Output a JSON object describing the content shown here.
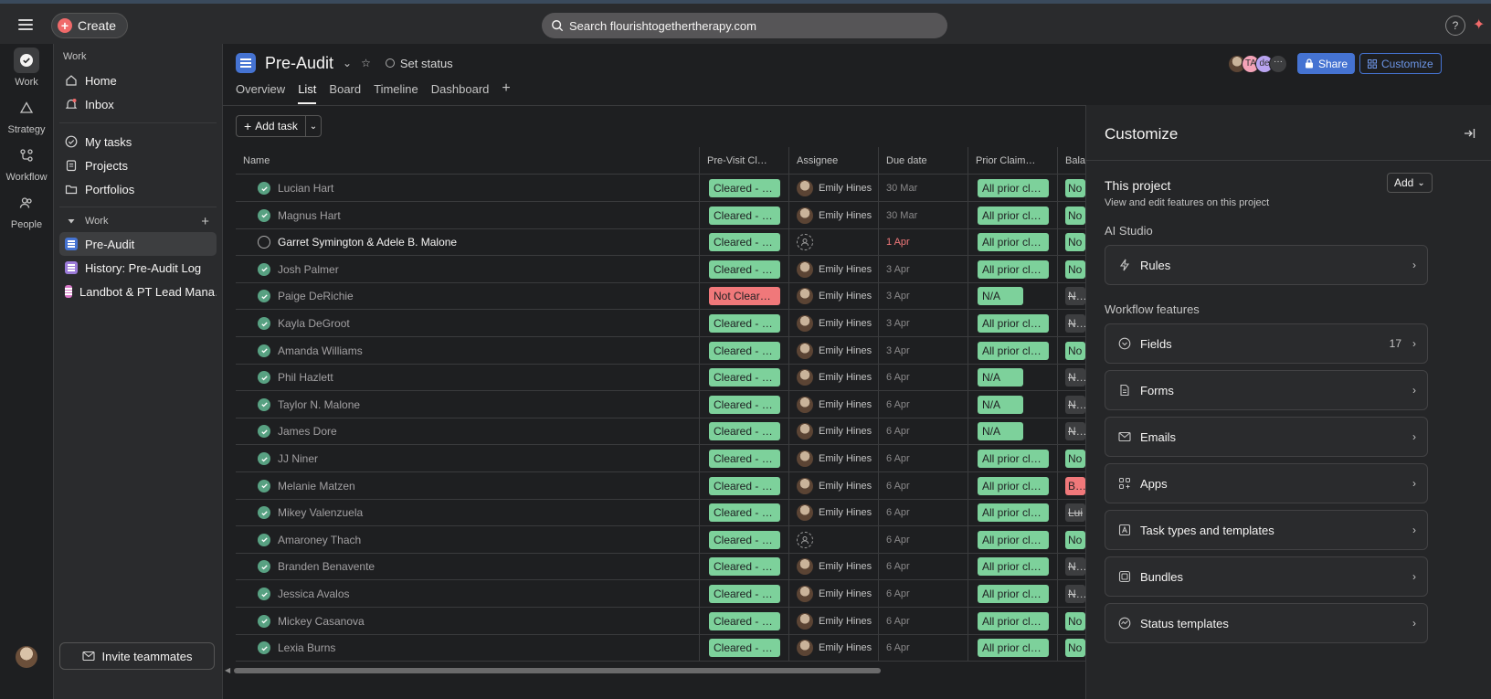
{
  "topbar": {
    "create_label": "Create",
    "search_placeholder": "Search flourishtogethertherapy.com",
    "help_label": "?"
  },
  "rail": {
    "items": [
      {
        "label": "Work"
      },
      {
        "label": "Strategy"
      },
      {
        "label": "Workflow"
      },
      {
        "label": "People"
      }
    ]
  },
  "sidebar": {
    "section_label": "Work",
    "home": "Home",
    "inbox": "Inbox",
    "my_tasks": "My tasks",
    "projects": "Projects",
    "portfolios": "Portfolios",
    "work_group": "Work",
    "projects_list": [
      {
        "label": "Pre-Audit",
        "color": "#4573d2"
      },
      {
        "label": "History: Pre-Audit Log",
        "color": "#9b7ad8"
      },
      {
        "label": "Landbot & PT Lead Mana…",
        "color": "#d878c8"
      }
    ],
    "invite_label": "Invite teammates"
  },
  "header": {
    "title": "Pre-Audit",
    "set_status": "Set status",
    "tabs": [
      "Overview",
      "List",
      "Board",
      "Timeline",
      "Dashboard"
    ],
    "active_tab": "List",
    "avatar_initials": [
      "TA",
      "de"
    ],
    "share_label": "Share",
    "customize_label": "Customize"
  },
  "toolbar": {
    "add_task_label": "Add task"
  },
  "table": {
    "columns": [
      "Name",
      "Pre-Visit Cl…",
      "Assignee",
      "Due date",
      "Prior Claim…",
      "Balan"
    ],
    "rows": [
      {
        "name": "Lucian Hart",
        "done": true,
        "pre": "Cleared - n…",
        "pre_status": "green",
        "assignee": "Emily Hines",
        "due": "30 Mar",
        "due_red": false,
        "prior": "All prior cla…",
        "prior_kind": "gwide",
        "bal": "No",
        "bal_kind": "balno"
      },
      {
        "name": "Magnus Hart",
        "done": true,
        "pre": "Cleared - n…",
        "pre_status": "green",
        "assignee": "Emily Hines",
        "due": "30 Mar",
        "due_red": false,
        "prior": "All prior cla…",
        "prior_kind": "gwide",
        "bal": "No",
        "bal_kind": "balno"
      },
      {
        "name": "Garret Symington & Adele B. Malone",
        "done": false,
        "pre": "Cleared - n…",
        "pre_status": "green",
        "assignee": "",
        "due": "1 Apr",
        "due_red": true,
        "prior": "All prior cla…",
        "prior_kind": "gwide",
        "bal": "No",
        "bal_kind": "balno"
      },
      {
        "name": "Josh Palmer",
        "done": true,
        "pre": "Cleared - n…",
        "pre_status": "green",
        "assignee": "Emily Hines",
        "due": "3 Apr",
        "due_red": false,
        "prior": "All prior cla…",
        "prior_kind": "gwide",
        "bal": "No",
        "bal_kind": "balno"
      },
      {
        "name": "Paige DeRichie",
        "done": true,
        "pre": "Not Cleare…",
        "pre_status": "red",
        "assignee": "Emily Hines",
        "due": "3 Apr",
        "due_red": false,
        "prior": "N/A",
        "prior_kind": "gnarrow",
        "bal": "N/A",
        "bal_kind": "balna"
      },
      {
        "name": "Kayla DeGroot",
        "done": true,
        "pre": "Cleared - n…",
        "pre_status": "green",
        "assignee": "Emily Hines",
        "due": "3 Apr",
        "due_red": false,
        "prior": "All prior cla…",
        "prior_kind": "gwide",
        "bal": "N/A",
        "bal_kind": "balna"
      },
      {
        "name": "Amanda Williams",
        "done": true,
        "pre": "Cleared - n…",
        "pre_status": "green",
        "assignee": "Emily Hines",
        "due": "3 Apr",
        "due_red": false,
        "prior": "All prior cla…",
        "prior_kind": "gwide",
        "bal": "No",
        "bal_kind": "balno"
      },
      {
        "name": "Phil Hazlett",
        "done": true,
        "pre": "Cleared - n…",
        "pre_status": "green",
        "assignee": "Emily Hines",
        "due": "6 Apr",
        "due_red": false,
        "prior": "N/A",
        "prior_kind": "gnarrow",
        "bal": "N/A",
        "bal_kind": "balna"
      },
      {
        "name": "Taylor N. Malone",
        "done": true,
        "pre": "Cleared - n…",
        "pre_status": "green",
        "assignee": "Emily Hines",
        "due": "6 Apr",
        "due_red": false,
        "prior": "N/A",
        "prior_kind": "gnarrow",
        "bal": "N/A",
        "bal_kind": "balna"
      },
      {
        "name": "James Dore",
        "done": true,
        "pre": "Cleared - n…",
        "pre_status": "green",
        "assignee": "Emily Hines",
        "due": "6 Apr",
        "due_red": false,
        "prior": "N/A",
        "prior_kind": "gnarrow",
        "bal": "N/A",
        "bal_kind": "balna"
      },
      {
        "name": "JJ Niner",
        "done": true,
        "pre": "Cleared - n…",
        "pre_status": "green",
        "assignee": "Emily Hines",
        "due": "6 Apr",
        "due_red": false,
        "prior": "All prior cla…",
        "prior_kind": "gwide",
        "bal": "No",
        "bal_kind": "balno"
      },
      {
        "name": "Melanie Matzen",
        "done": true,
        "pre": "Cleared - n…",
        "pre_status": "green",
        "assignee": "Emily Hines",
        "due": "6 Apr",
        "due_red": false,
        "prior": "All prior cla…",
        "prior_kind": "gwide",
        "bal": "Bal",
        "bal_kind": "balred"
      },
      {
        "name": "Mikey Valenzuela",
        "done": true,
        "pre": "Cleared - n…",
        "pre_status": "green",
        "assignee": "Emily Hines",
        "due": "6 Apr",
        "due_red": false,
        "prior": "All prior cla…",
        "prior_kind": "gwide",
        "bal": "Lui",
        "bal_kind": "balna"
      },
      {
        "name": "Amaroney Thach",
        "done": true,
        "pre": "Cleared - n…",
        "pre_status": "green",
        "assignee": "",
        "due": "6 Apr",
        "due_red": false,
        "prior": "All prior cla…",
        "prior_kind": "gwide",
        "bal": "No",
        "bal_kind": "balno"
      },
      {
        "name": "Branden Benavente",
        "done": true,
        "pre": "Cleared - n…",
        "pre_status": "green",
        "assignee": "Emily Hines",
        "due": "6 Apr",
        "due_red": false,
        "prior": "All prior cla…",
        "prior_kind": "gwide",
        "bal": "N/A",
        "bal_kind": "balna"
      },
      {
        "name": "Jessica Avalos",
        "done": true,
        "pre": "Cleared - n…",
        "pre_status": "green",
        "assignee": "Emily Hines",
        "due": "6 Apr",
        "due_red": false,
        "prior": "All prior cla…",
        "prior_kind": "gwide",
        "bal": "N/A",
        "bal_kind": "balna"
      },
      {
        "name": "Mickey Casanova",
        "done": true,
        "pre": "Cleared - n…",
        "pre_status": "green",
        "assignee": "Emily Hines",
        "due": "6 Apr",
        "due_red": false,
        "prior": "All prior cla…",
        "prior_kind": "gwide",
        "bal": "No",
        "bal_kind": "balno"
      },
      {
        "name": "Lexia Burns",
        "done": true,
        "pre": "Cleared - n…",
        "pre_status": "green",
        "assignee": "Emily Hines",
        "due": "6 Apr",
        "due_red": false,
        "prior": "All prior cla…",
        "prior_kind": "gwide",
        "bal": "No",
        "bal_kind": "balno"
      }
    ]
  },
  "panel": {
    "title": "Customize",
    "this_project": "This project",
    "this_project_sub": "View and edit features on this project",
    "add_label": "Add",
    "ai_studio_label": "AI Studio",
    "rules_label": "Rules",
    "workflow_label": "Workflow features",
    "features": [
      {
        "label": "Fields",
        "count": "17",
        "icon": "fields-icon"
      },
      {
        "label": "Forms",
        "count": "",
        "icon": "forms-icon"
      },
      {
        "label": "Emails",
        "count": "",
        "icon": "email-icon"
      },
      {
        "label": "Apps",
        "count": "",
        "icon": "apps-icon"
      },
      {
        "label": "Task types and templates",
        "count": "",
        "icon": "template-icon"
      },
      {
        "label": "Bundles",
        "count": "",
        "icon": "bundle-icon"
      },
      {
        "label": "Status templates",
        "count": "",
        "icon": "status-icon"
      }
    ]
  }
}
